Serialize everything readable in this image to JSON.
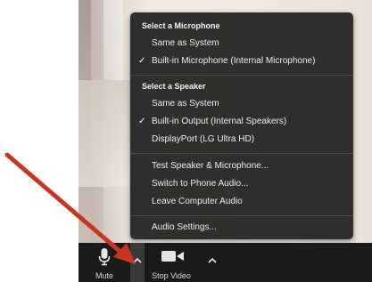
{
  "audio_menu": {
    "microphone_header": "Select a Microphone",
    "microphone_items": [
      {
        "label": "Same as System",
        "checked": false
      },
      {
        "label": "Built-in Microphone (Internal Microphone)",
        "checked": true
      }
    ],
    "speaker_header": "Select a Speaker",
    "speaker_items": [
      {
        "label": "Same as System",
        "checked": false
      },
      {
        "label": "Built-in Output (Internal Speakers)",
        "checked": true
      },
      {
        "label": "DisplayPort (LG Ultra HD)",
        "checked": false
      }
    ],
    "actions": [
      {
        "label": "Test Speaker & Microphone..."
      },
      {
        "label": "Switch to Phone Audio..."
      },
      {
        "label": "Leave Computer Audio"
      }
    ],
    "settings_label": "Audio Settings...",
    "check_glyph": "✓"
  },
  "toolbar": {
    "mute_label": "Mute",
    "stop_video_label": "Stop Video",
    "chevron_glyph": "^"
  },
  "icons": {
    "microphone": "microphone-icon",
    "video_camera": "video-camera-icon",
    "chevron_up": "chevron-up-icon",
    "checkmark": "checkmark-icon",
    "annotation_arrow": "red-arrow"
  },
  "colors": {
    "menu_bg": "#262626",
    "toolbar_bg": "#1a1a1a",
    "arrow": "#c8361f"
  }
}
